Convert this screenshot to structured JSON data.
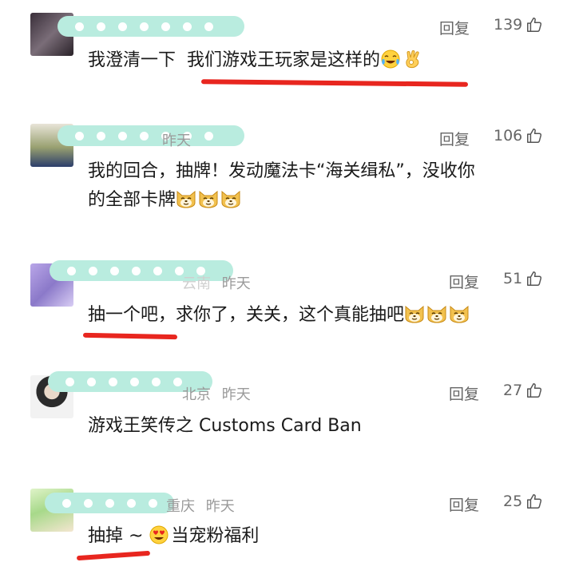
{
  "comments": [
    {
      "meta": "",
      "reply": "回复",
      "likes": "139",
      "text_a": "我澄清一下  我们游戏王玩家是这样的",
      "emoji": [
        "crying-laughing-emoji",
        "ok-hand-emoji"
      ]
    },
    {
      "meta": "昨天",
      "reply": "回复",
      "likes": "106",
      "text_a": "我的回合，抽牌！发动魔法卡“海关缉私”，没收你",
      "text_b": "的全部卡牌",
      "emoji": [
        "doge-emoji",
        "doge-emoji",
        "doge-emoji"
      ]
    },
    {
      "meta_loc": "云南",
      "meta_time": "昨天",
      "reply": "回复",
      "likes": "51",
      "text_a": "抽一个吧，求你了，关关，这个真能抽吧",
      "emoji": [
        "doge-emoji",
        "doge-emoji",
        "doge-emoji"
      ]
    },
    {
      "meta_loc": "北京",
      "meta_time": "昨天",
      "reply": "回复",
      "likes": "27",
      "text_a": "游戏王笑传之 Customs Card Ban"
    },
    {
      "meta_loc": "重庆",
      "meta_time": "昨天",
      "reply": "回复",
      "likes": "25",
      "text_pre": "抽掉 ~ ",
      "text_post": "当宠粉福利",
      "emoji": [
        "heart-eyes-emoji"
      ]
    }
  ],
  "colors": {
    "accent_red": "#e8261f",
    "redaction": "#b9ecdf",
    "meta_gray": "#9a9a9a"
  }
}
